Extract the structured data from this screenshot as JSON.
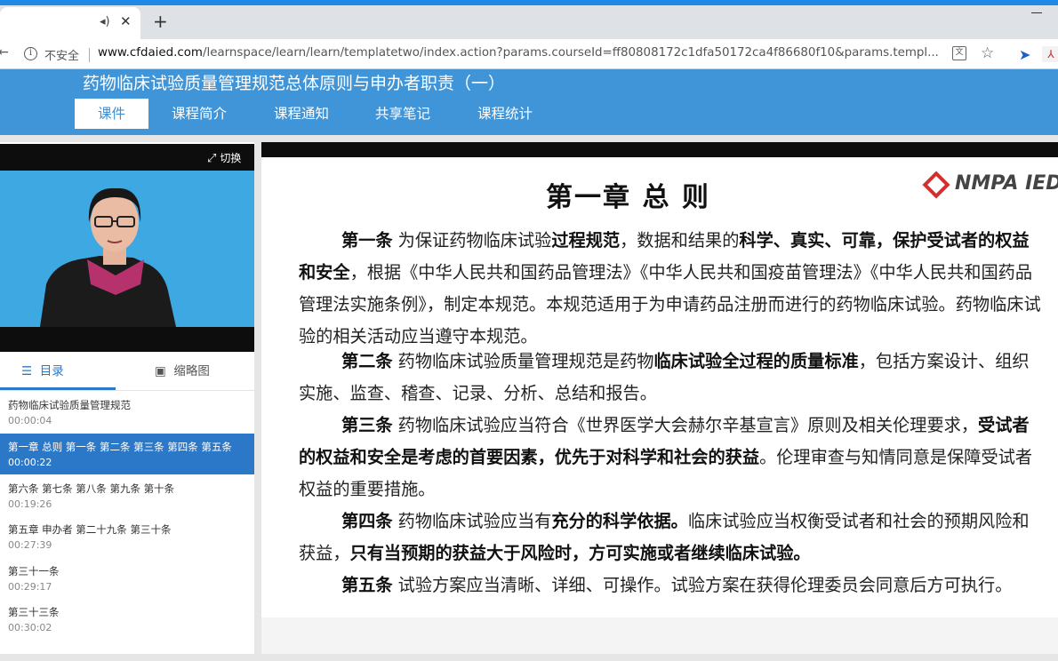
{
  "browser": {
    "tab": {
      "speaker_icon": "speaker-icon",
      "close": "✕"
    },
    "new_tab": "+",
    "insecure_label": "不安全",
    "url_host": "www.cfdaied.com",
    "url_path": "/learnspace/learn/learn/templatetwo/index.action?params.courseId=ff80808172c1dfa50172ca4f86680f10&params.templ..."
  },
  "site": {
    "course_title": "药物临床试验质量管理规范总体原则与申办者职责（一）",
    "nav": [
      "课件",
      "课程简介",
      "课程通知",
      "共享笔记",
      "课程统计"
    ]
  },
  "player": {
    "switch_label": "切换",
    "toc_tab": "目录",
    "thumb_tab": "缩略图",
    "toc": [
      {
        "title": "药物临床试验质量管理规范",
        "time": "00:00:04"
      },
      {
        "title": "第一章 总则 第一条 第二条 第三条 第四条 第五条",
        "time": "00:00:22"
      },
      {
        "title": "第六条 第七条 第八条 第九条 第十条",
        "time": "00:19:26"
      },
      {
        "title": "第五章 申办者 第二十九条 第三十条",
        "time": "00:27:39"
      },
      {
        "title": "第三十一条",
        "time": "00:29:17"
      },
      {
        "title": "第三十三条",
        "time": "00:30:02"
      }
    ]
  },
  "slide": {
    "title": "第一章  总  则",
    "logo_text": "NMPA IED",
    "articles": [
      {
        "segments": [
          [
            "b",
            "第一条"
          ],
          [
            "n",
            "  为保证药物临床试验"
          ],
          [
            "b",
            "过程规范"
          ],
          [
            "n",
            "，数据和结果的"
          ],
          [
            "b",
            "科学、真实、可靠，保护受试者的权益和安全"
          ],
          [
            "n",
            "，根据《中华人民共和国药品管理法》《中华人民共和国疫苗管理法》《中华人民共和国药品管理法实施条例》，制定本规范。本规范适用于为申请药品注册而进行的药物临床试验。药物临床试验的相关活动应当遵守本规范。"
          ]
        ]
      },
      {
        "segments": [
          [
            "b",
            "第二条"
          ],
          [
            "n",
            "  药物临床试验质量管理规范是药物"
          ],
          [
            "b",
            "临床试验全过程的质量标准"
          ],
          [
            "n",
            "，包括方案设计、组织实施、监查、稽查、记录、分析、总结和报告。"
          ]
        ]
      },
      {
        "segments": [
          [
            "b",
            "第三条"
          ],
          [
            "n",
            "  药物临床试验应当符合《世界医学大会赫尔辛基宣言》原则及相关伦理要求，"
          ],
          [
            "b",
            "受试者的权益和安全是考虑的首要因素，优先于对科学和社会的获益"
          ],
          [
            "n",
            "。伦理审查与知情同意是保障受试者权益的重要措施。"
          ]
        ]
      },
      {
        "segments": [
          [
            "b",
            "第四条"
          ],
          [
            "n",
            "  药物临床试验应当有"
          ],
          [
            "b",
            "充分的科学依据。"
          ],
          [
            "n",
            "临床试验应当权衡受试者和社会的预期风险和获益，"
          ],
          [
            "b",
            "只有当预期的获益大于风险时，方可实施或者继续临床试验。"
          ]
        ]
      },
      {
        "segments": [
          [
            "b",
            "第五条"
          ],
          [
            "n",
            "  试验方案应当清晰、详细、可操作。试验方案在获得伦理委员会同意后方可执行。"
          ]
        ]
      }
    ]
  },
  "colors": {
    "header_blue": "#3f95d8",
    "active_item": "#2b78c9",
    "video_bg": "#3ea8e3",
    "logo_red": "#d32f2f"
  }
}
